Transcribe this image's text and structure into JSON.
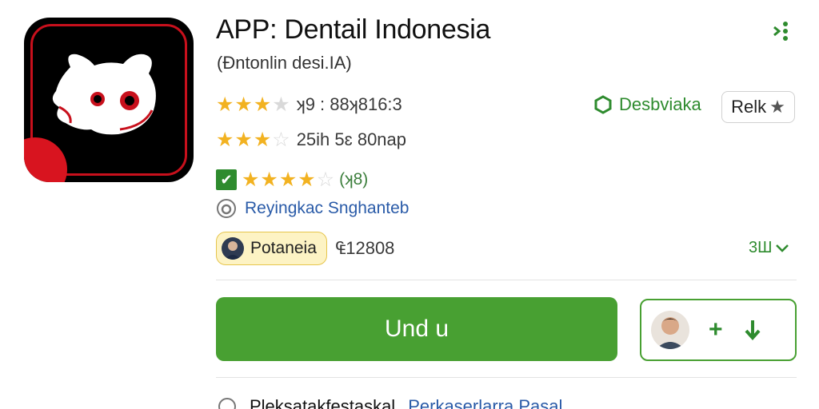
{
  "app": {
    "title": "APP: Dentail Indonesia",
    "subtitle": "(Ɖntonlin desi.IA)",
    "icon_name": "bear-face-app-icon"
  },
  "ratings": {
    "primary_text": "ʞ9 : 88ʞ816:3",
    "secondary_text": "25ih 5ɛ 80nap",
    "review_count": "(ʞ8)",
    "primary_stars": 3.5,
    "secondary_stars": 3.5,
    "verified_stars": 4.5
  },
  "developer_link": {
    "label": "Desbviaka",
    "icon": "hexagon-icon"
  },
  "rate_button": {
    "label": "Relk",
    "icon": "star-icon"
  },
  "support_link": {
    "label": "Reyingkac Snghanteb",
    "icon": "info-circle-icon"
  },
  "developer_pill": {
    "label": "Potaneia",
    "icon": "avatar"
  },
  "price_text": "₠12808",
  "size_link": {
    "label": "3Ш",
    "icon": "chevron-down-icon"
  },
  "install_button": {
    "label": "Und u"
  },
  "action_card": {
    "add_icon": "plus-icon",
    "download_icon": "download-arrow-icon"
  },
  "footer": {
    "left_text": "Pleksatakfestaskal",
    "right_text": "Perkaserlarra Pasal"
  },
  "colors": {
    "brand_green": "#48a032",
    "star_gold": "#f2b221",
    "link_blue": "#2a5ba8",
    "icon_red": "#c8101c"
  }
}
